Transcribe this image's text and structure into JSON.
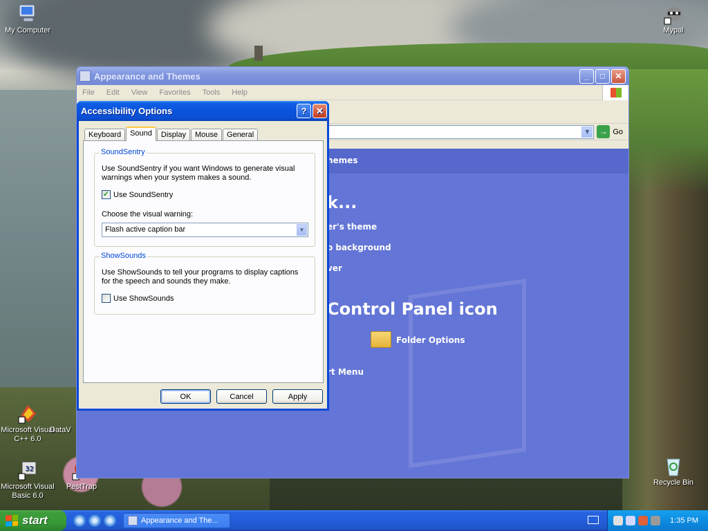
{
  "desktop": {
    "icons": [
      {
        "id": "my-computer",
        "label": "My Computer"
      },
      {
        "id": "mypal",
        "label": "Mypal"
      },
      {
        "id": "msvc6",
        "label": "Microsoft Visual C++ 6.0"
      },
      {
        "id": "datav",
        "label": "DataV"
      },
      {
        "id": "msvb6",
        "label": "Microsoft Visual Basic 6.0"
      },
      {
        "id": "pestrap",
        "label": "PestTrap"
      },
      {
        "id": "recycle-bin",
        "label": "Recycle Bin"
      }
    ]
  },
  "explorer": {
    "title": "Appearance and Themes",
    "menu": [
      "File",
      "Edit",
      "View",
      "Favorites",
      "Tools",
      "Help"
    ],
    "go_label": "Go",
    "content": {
      "header": "hemes",
      "pick_task": "k...",
      "tasks": [
        "er's theme",
        "o background",
        "ver"
      ],
      "pick_icon": "Control Panel icon",
      "folder_options": "Folder Options",
      "start_menu": "rt Menu"
    }
  },
  "dialog": {
    "title": "Accessibility Options",
    "help_btn": "?",
    "tabs": [
      "Keyboard",
      "Sound",
      "Display",
      "Mouse",
      "General"
    ],
    "active_tab": "Sound",
    "soundsentry": {
      "title": "SoundSentry",
      "desc": "Use SoundSentry if you want Windows to generate visual warnings when your system makes a sound.",
      "checkbox_label": "Use SoundSentry",
      "checked": true,
      "choose_label": "Choose the visual warning:",
      "selected": "Flash active caption bar"
    },
    "showsounds": {
      "title": "ShowSounds",
      "desc": "Use ShowSounds to tell your programs to display captions for the speech and sounds they make.",
      "checkbox_label": "Use ShowSounds",
      "checked": false
    },
    "buttons": {
      "ok": "OK",
      "cancel": "Cancel",
      "apply": "Apply"
    }
  },
  "taskbar": {
    "start_label": "start",
    "task_label": "Appearance and The...",
    "clock": "1:35 PM"
  }
}
